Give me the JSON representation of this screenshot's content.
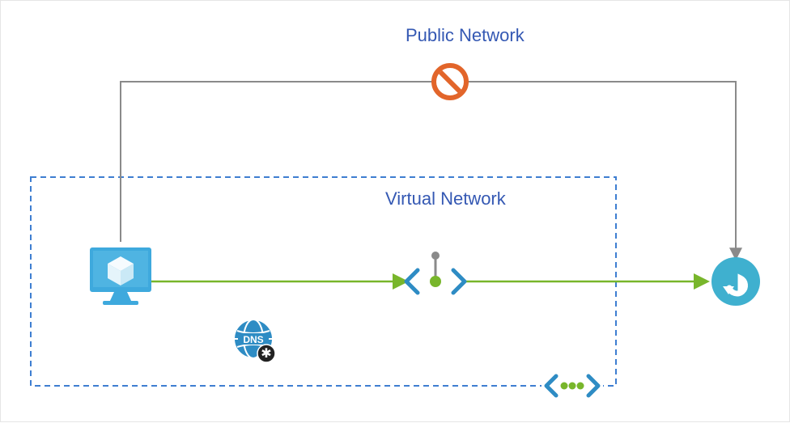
{
  "labels": {
    "public_network": "Public Network",
    "virtual_network": "Virtual Network"
  },
  "icons": {
    "vm": "virtual-machine",
    "private_endpoint": "private-endpoint",
    "vnet_connector": "virtual-network-connector",
    "dns": "private-dns-zone",
    "relay": "azure-relay",
    "blocked": "blocked-icon"
  },
  "colors": {
    "accent_blue": "#3458b3",
    "azure_blue": "#1aa6d6",
    "dark_azure": "#2E8CC4",
    "green": "#78b62b",
    "orange": "#e2652a",
    "gray": "#8a8a8a",
    "dashed_blue": "#3e7ed1"
  }
}
